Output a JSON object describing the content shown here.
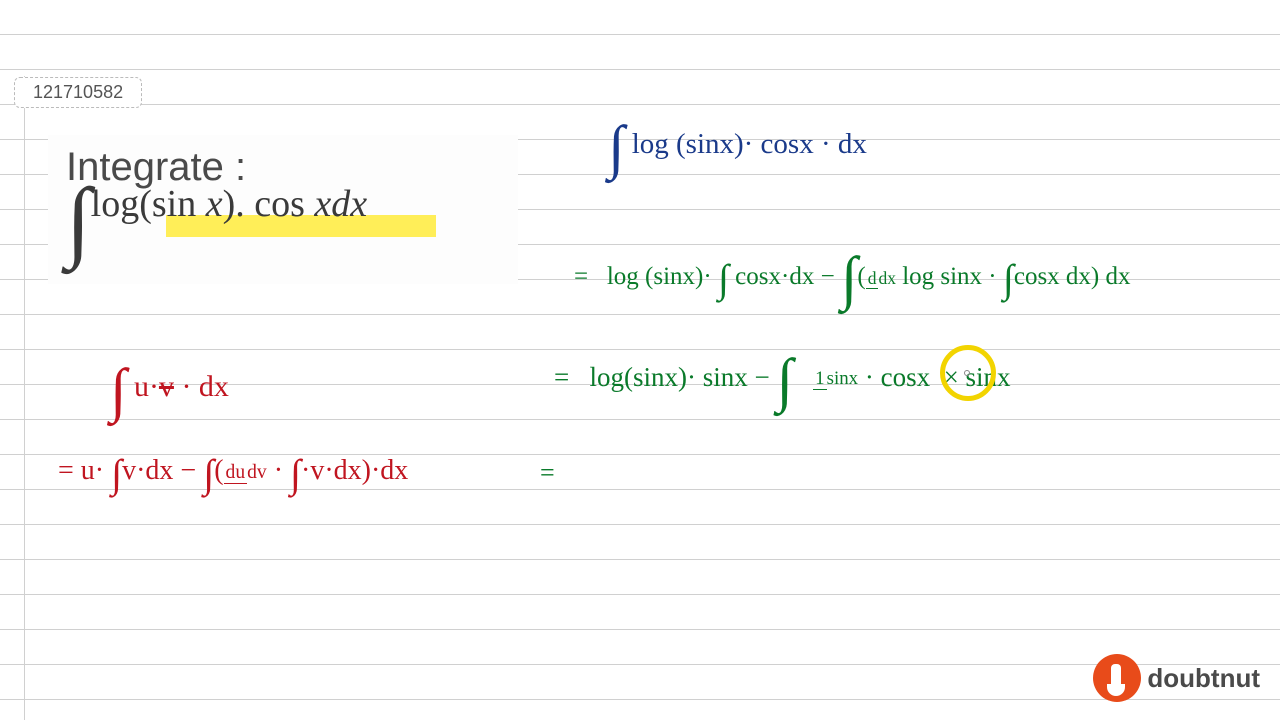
{
  "id": "121710582",
  "problem": {
    "title": "Integrate :",
    "expression": "∫log(sin x). cos xdx"
  },
  "handwriting": {
    "red1": "∫ u·v · dx",
    "red2": "= u· ∫v·dx − ∫(du/dv · ∫·v·dx)·dx",
    "blue1": "∫ log (sinx)· cosx · dx",
    "green1": "= log (sinx)· ∫ cosx·dx − ∫(d/dx log sinx · ∫cosx dx) dx",
    "green2": "= log(sinx)· sinx − ∫ 1/sinx · cosx × sinx",
    "green3": "="
  },
  "brand": "doubtnut"
}
